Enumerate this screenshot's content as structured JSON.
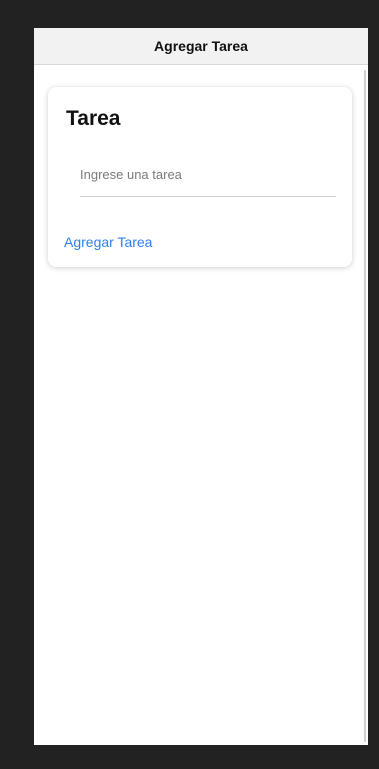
{
  "header": {
    "title": "Agregar Tarea"
  },
  "card": {
    "title": "Tarea",
    "input": {
      "value": "",
      "placeholder": "Ingrese una tarea"
    },
    "action_label": "Agregar Tarea"
  },
  "colors": {
    "frame": "#222222",
    "header_bg": "#f2f2f2",
    "link": "#2f80ed"
  }
}
